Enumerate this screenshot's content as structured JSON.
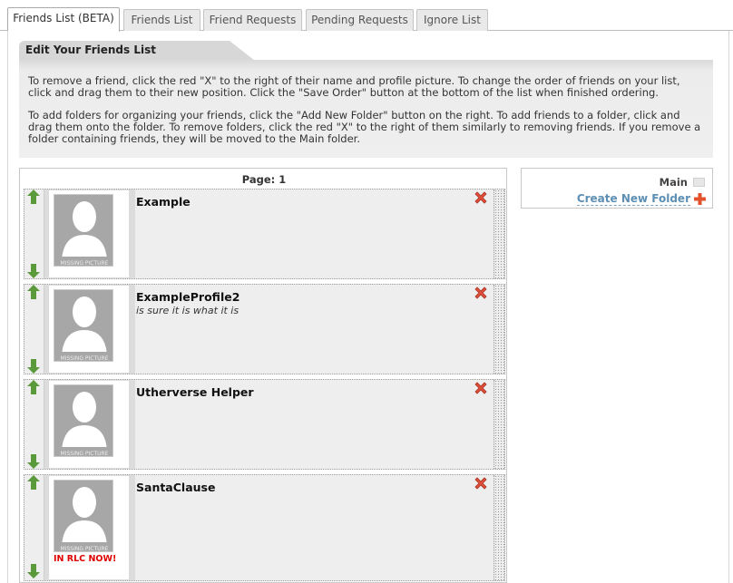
{
  "tabs": [
    {
      "label": "Friends List (BETA)",
      "active": true
    },
    {
      "label": "Friends List",
      "active": false
    },
    {
      "label": "Friend Requests",
      "active": false
    },
    {
      "label": "Pending Requests",
      "active": false
    },
    {
      "label": "Ignore List",
      "active": false
    }
  ],
  "edit": {
    "title": "Edit Your Friends List",
    "paragraph1": "To remove a friend, click the red \"X\" to the right of their name and profile picture. To change the order of friends on your list, click and drag them to their new position. Click the \"Save Order\" button at the bottom of the list when finished ordering.",
    "paragraph2": "To add folders for organizing your friends, click the \"Add New Folder\" button on the right. To add friends to a folder, click and drag them onto the folder. To remove folders, click the red \"X\" to the right of them similarly to removing friends. If you remove a folder containing friends, they will be moved to the Main folder."
  },
  "list": {
    "page_label": "Page: 1",
    "photo_caption": "MISSING PICTURE",
    "friends": [
      {
        "name": "Example",
        "status": "",
        "badge": ""
      },
      {
        "name": "ExampleProfile2",
        "status": "is sure it is what it is",
        "badge": ""
      },
      {
        "name": "Utherverse Helper",
        "status": "",
        "badge": ""
      },
      {
        "name": "SantaClause",
        "status": "",
        "badge": "IN RLC NOW!"
      }
    ]
  },
  "folders": {
    "main_label": "Main",
    "create_label": "Create New Folder"
  },
  "icons": {
    "move_up": "green-up-arrow-icon",
    "move_down": "green-down-arrow-icon",
    "remove": "red-x-icon",
    "folder": "folder-icon",
    "add": "plus-icon"
  },
  "colors": {
    "arrow_green": "#5a9a3a",
    "remove_red": "#e0503a",
    "link_blue": "#5d8fb5",
    "online_red": "#e00000"
  }
}
